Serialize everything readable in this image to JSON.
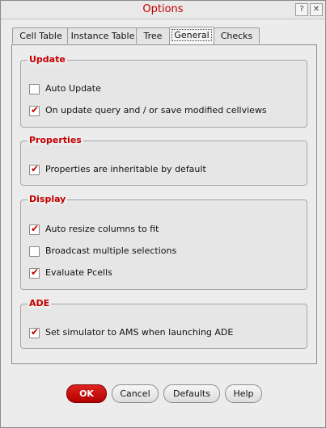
{
  "window": {
    "title": "Options",
    "help_glyph": "?",
    "close_glyph": "✕"
  },
  "tabs": [
    {
      "label": "Cell Table",
      "active": false
    },
    {
      "label": "Instance Table",
      "active": false
    },
    {
      "label": "Tree",
      "active": false
    },
    {
      "label": "General",
      "active": true
    },
    {
      "label": "Checks",
      "active": false
    }
  ],
  "groups": {
    "update": {
      "title": "Update",
      "items": [
        {
          "label": "Auto Update",
          "checked": false
        },
        {
          "label": "On update query and / or save modified cellviews",
          "checked": true
        }
      ]
    },
    "properties": {
      "title": "Properties",
      "items": [
        {
          "label": "Properties are inheritable by default",
          "checked": true
        }
      ]
    },
    "display": {
      "title": "Display",
      "items": [
        {
          "label": "Auto resize columns to fit",
          "checked": true
        },
        {
          "label": "Broadcast multiple selections",
          "checked": false
        },
        {
          "label": "Evaluate Pcells",
          "checked": true
        }
      ]
    },
    "ade": {
      "title": "ADE",
      "items": [
        {
          "label": "Set simulator to AMS when launching ADE",
          "checked": true
        }
      ]
    }
  },
  "buttons": {
    "ok": "OK",
    "cancel": "Cancel",
    "defaults": "Defaults",
    "help": "Help"
  },
  "colors": {
    "accent": "#c40000",
    "ok_button": "#c80000"
  }
}
